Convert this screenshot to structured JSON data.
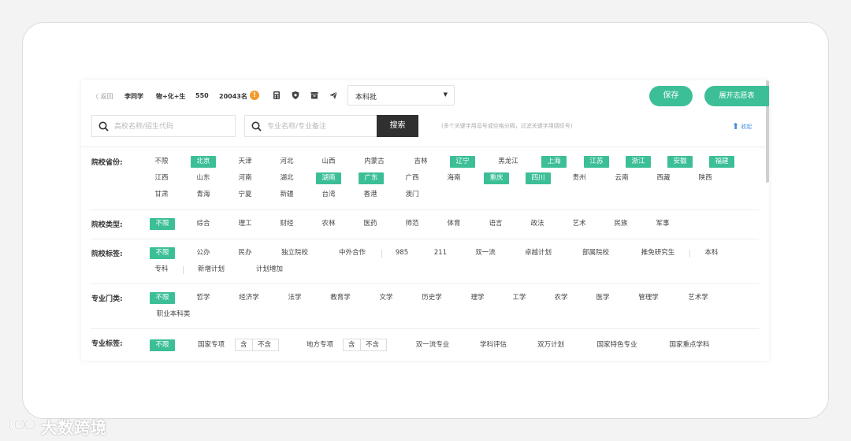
{
  "topbar": {
    "back_label": "〈 返回",
    "student_name": "李同学",
    "subjects": "物+化+生",
    "score": "550",
    "rank": "20043名",
    "rank_badge": "!",
    "batch_select": "本科批",
    "save_label": "保存",
    "open_label": "展开志愿表",
    "accent_color": "#3cbf97"
  },
  "search": {
    "school_placeholder": "高校名称/招生代码",
    "major_placeholder": "专业名称/专业备注",
    "search_button": "搜索",
    "hint": "(多个关键字用逗号或空格分隔，过滤关键字用感叹号)",
    "collapse_label": "收起"
  },
  "filters": {
    "province": {
      "label": "院校省份:",
      "items": [
        "不限",
        "北京",
        "天津",
        "河北",
        "山西",
        "内蒙古",
        "吉林",
        "辽宁",
        "黑龙江",
        "上海",
        "江苏",
        "浙江",
        "安徽",
        "福建",
        "江西",
        "山东",
        "河南",
        "湖北",
        "湖南",
        "广东",
        "广西",
        "海南",
        "重庆",
        "四川",
        "贵州",
        "云南",
        "西藏",
        "陕西",
        "甘肃",
        "青海",
        "宁夏",
        "新疆",
        "台湾",
        "香港",
        "澳门"
      ]
    },
    "type": {
      "label": "院校类型:",
      "items": [
        "不限",
        "综合",
        "理工",
        "财经",
        "农林",
        "医药",
        "师范",
        "体育",
        "语言",
        "政法",
        "艺术",
        "民族",
        "军事"
      ]
    },
    "tag": {
      "label": "院校标签:",
      "items": [
        "不限",
        "公办",
        "民办",
        "独立院校",
        "中外合作",
        "985",
        "211",
        "双一流",
        "卓越计划",
        "部属院校",
        "推免研究生",
        "本科",
        "专科",
        "新增计划",
        "计划增加"
      ]
    },
    "category": {
      "label": "专业门类:",
      "items": [
        "不限",
        "哲学",
        "经济学",
        "法学",
        "教育学",
        "文学",
        "历史学",
        "理学",
        "工学",
        "农学",
        "医学",
        "管理学",
        "艺术学",
        "职业本科类"
      ]
    },
    "major_tag": {
      "label": "专业标签:",
      "items": [
        "不限",
        "国家专项",
        "含",
        "不含",
        "地方专项",
        "含",
        "不含",
        "双一流专业",
        "学科评估",
        "双万计划",
        "国家特色专业",
        "国家重点学科"
      ]
    }
  },
  "watermark": "大数跨境"
}
